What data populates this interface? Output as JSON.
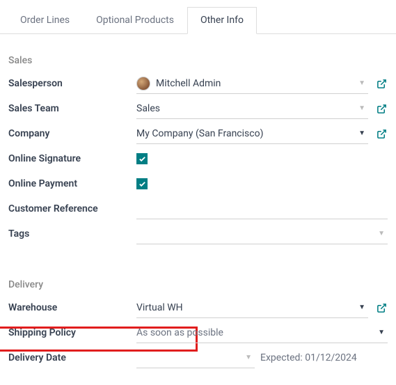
{
  "tabs": {
    "order_lines": "Order Lines",
    "optional_products": "Optional Products",
    "other_info": "Other Info"
  },
  "sales": {
    "section_title": "Sales",
    "salesperson_label": "Salesperson",
    "salesperson_value": "Mitchell Admin",
    "sales_team_label": "Sales Team",
    "sales_team_value": "Sales",
    "company_label": "Company",
    "company_value": "My Company (San Francisco)",
    "online_signature_label": "Online Signature",
    "online_signature_checked": true,
    "online_payment_label": "Online Payment",
    "online_payment_checked": true,
    "customer_reference_label": "Customer Reference",
    "customer_reference_value": "",
    "tags_label": "Tags",
    "tags_value": ""
  },
  "delivery": {
    "section_title": "Delivery",
    "warehouse_label": "Warehouse",
    "warehouse_value": "Virtual WH",
    "shipping_policy_label": "Shipping Policy",
    "shipping_policy_value": "As soon as possible",
    "delivery_date_label": "Delivery Date",
    "delivery_date_value": "",
    "expected_prefix": "Expected: ",
    "expected_date": "01/12/2024"
  }
}
